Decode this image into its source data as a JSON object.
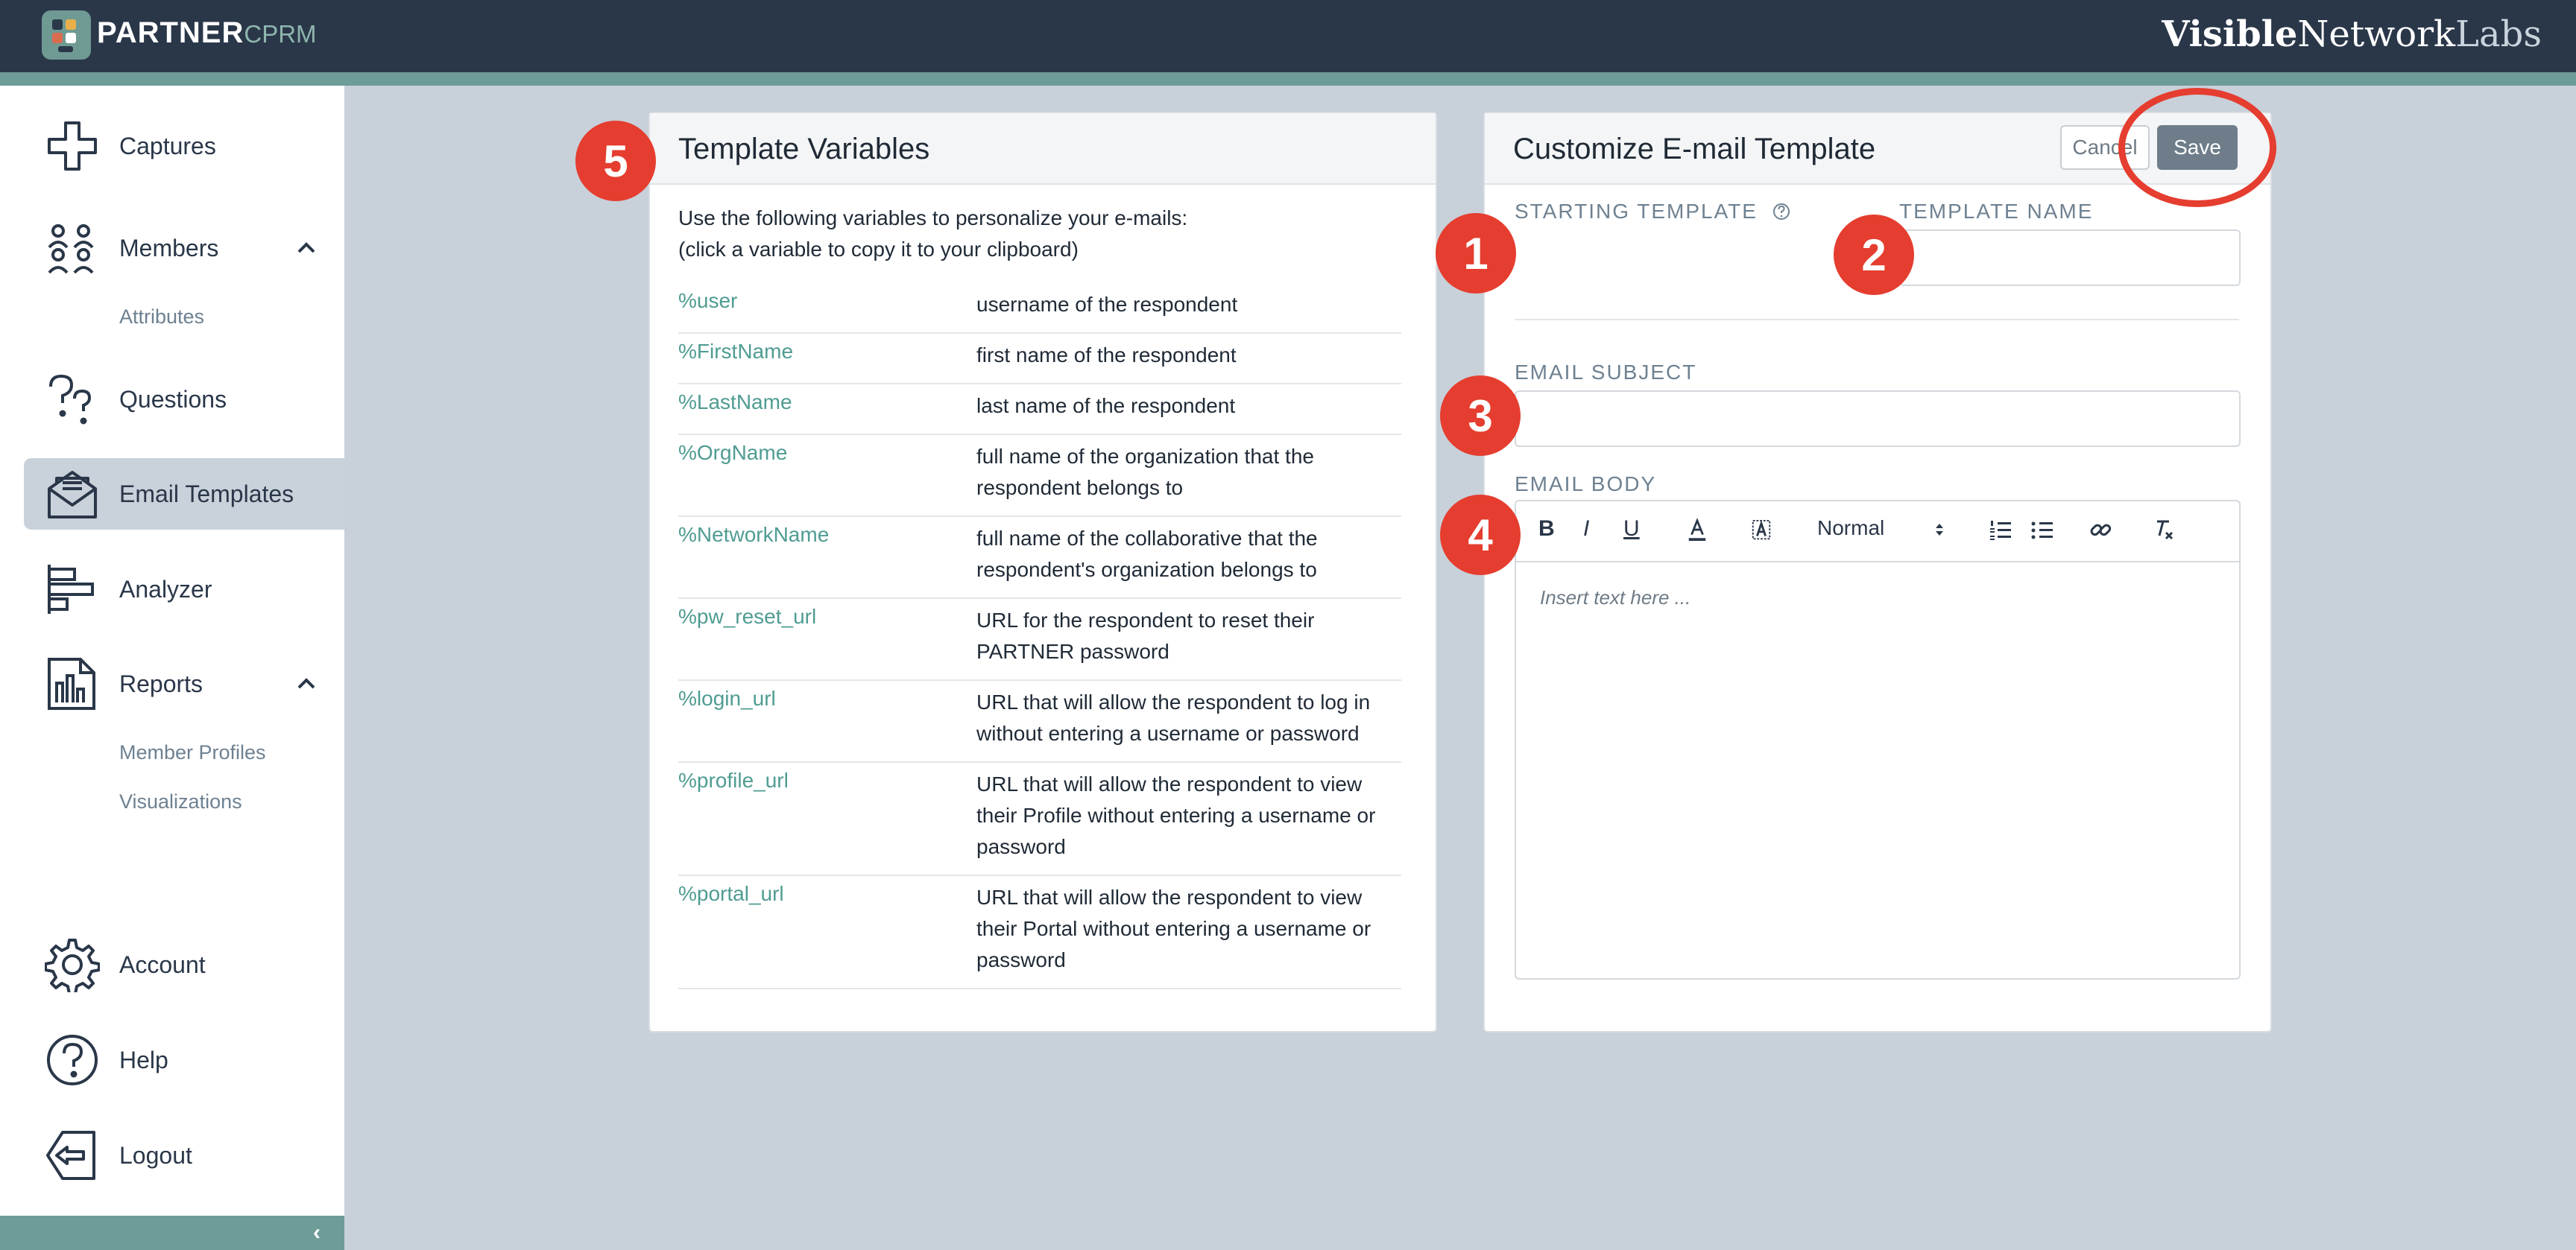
{
  "header": {
    "brand_main": "PARTNER",
    "brand_sub": "CPRM",
    "vendor_bold": "Visible",
    "vendor_mid": "Network",
    "vendor_light": "Labs"
  },
  "sidebar": {
    "items": [
      {
        "label": "Captures",
        "icon": "plus-cross-icon"
      },
      {
        "label": "Members",
        "icon": "people-icon"
      },
      {
        "label": "Questions",
        "icon": "question-marks-icon"
      },
      {
        "label": "Email Templates",
        "icon": "envelope-icon"
      },
      {
        "label": "Analyzer",
        "icon": "bars-icon"
      },
      {
        "label": "Reports",
        "icon": "report-chart-icon"
      },
      {
        "label": "Account",
        "icon": "gear-icon"
      },
      {
        "label": "Help",
        "icon": "help-circle-icon"
      },
      {
        "label": "Logout",
        "icon": "logout-icon"
      }
    ],
    "members_sub": [
      "Attributes"
    ],
    "reports_sub": [
      "Member Profiles",
      "Visualizations"
    ],
    "collapse_icon": "chevron-left-icon"
  },
  "variables_panel": {
    "title": "Template Variables",
    "intro_line1": "Use the following variables to personalize your e-mails:",
    "intro_line2": "(click a variable to copy it to your clipboard)",
    "rows": [
      {
        "name": "%user",
        "desc": "username of the respondent"
      },
      {
        "name": "%FirstName",
        "desc": "first name of the respondent"
      },
      {
        "name": "%LastName",
        "desc": "last name of the respondent"
      },
      {
        "name": "%OrgName",
        "desc": "full name of the organization that the respondent belongs to"
      },
      {
        "name": "%NetworkName",
        "desc": "full name of the collaborative that the respondent's organization belongs to"
      },
      {
        "name": "%pw_reset_url",
        "desc": "URL for the respondent to reset their PARTNER password"
      },
      {
        "name": "%login_url",
        "desc": "URL that will allow the respondent to log in without entering a username or password"
      },
      {
        "name": "%profile_url",
        "desc": "URL that will allow the respondent to view their Profile without entering a username or password"
      },
      {
        "name": "%portal_url",
        "desc": "URL that will allow the respondent to view their Portal without entering a username or password"
      }
    ]
  },
  "customize_panel": {
    "title": "Customize E-mail Template",
    "cancel_label": "Cancel",
    "save_label": "Save",
    "starting_template_label": "STARTING TEMPLATE",
    "template_name_label": "TEMPLATE NAME",
    "email_subject_label": "EMAIL SUBJECT",
    "email_body_label": "EMAIL BODY",
    "heading_select_value": "Normal",
    "body_placeholder": "Insert text here ...",
    "toolbar": {
      "bold": "B",
      "italic": "I",
      "underline": "U"
    }
  },
  "annotations": [
    "1",
    "2",
    "3",
    "4",
    "5"
  ],
  "colors": {
    "topbar": "#2a3749",
    "accent": "#6e9c96",
    "link": "#4f9c92",
    "annotation": "#e53d2f",
    "save_button": "#6e7d89"
  }
}
